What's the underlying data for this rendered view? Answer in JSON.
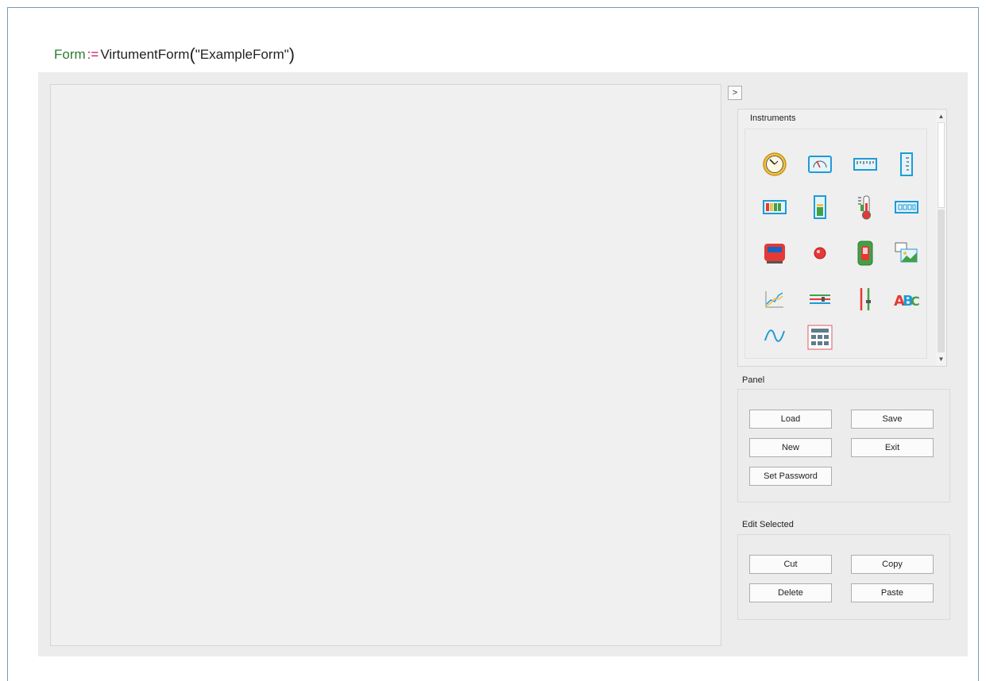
{
  "code": {
    "variable": "Form",
    "assign": ":=",
    "function": "VirtumentForm",
    "open_paren": "(",
    "argument": "\"ExampleForm\"",
    "close_paren": ")"
  },
  "toggle_button": {
    "label": ">"
  },
  "instruments": {
    "title": "Instruments",
    "icons": [
      "clock-gauge-icon",
      "analog-meter-icon",
      "linear-scale-icon",
      "vertical-scale-icon",
      "bar-graph-icon",
      "tank-level-icon",
      "thermometer-icon",
      "digital-display-icon",
      "red-device-icon",
      "red-led-icon",
      "switch-icon",
      "image-icon",
      "chart-icon",
      "horizontal-slider-icon",
      "vertical-slider-icon",
      "text-label-icon",
      "waveform-icon",
      "table-grid-icon"
    ]
  },
  "panel": {
    "title": "Panel",
    "load_label": "Load",
    "save_label": "Save",
    "new_label": "New",
    "exit_label": "Exit",
    "set_password_label": "Set Password"
  },
  "edit_selected": {
    "title": "Edit Selected",
    "cut_label": "Cut",
    "copy_label": "Copy",
    "delete_label": "Delete",
    "paste_label": "Paste"
  },
  "colors": {
    "variable": "#2e7d32",
    "operator": "#c2185b",
    "accent": "#2196f3",
    "gold": "#f5c242",
    "red": "#e53935"
  }
}
